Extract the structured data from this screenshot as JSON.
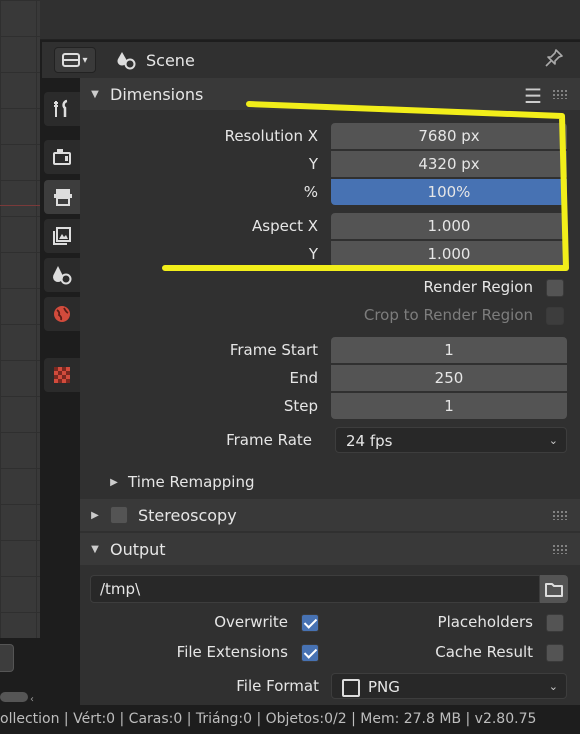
{
  "header": {
    "scene_label": "Scene"
  },
  "tabs": [
    "tool-icon",
    "render-icon",
    "output-icon",
    "view-layer-icon",
    "scene-icon",
    "world-icon",
    "texture-icon"
  ],
  "dimensions": {
    "title": "Dimensions",
    "resolution_x_label": "Resolution X",
    "resolution_x": "7680 px",
    "resolution_y_label": "Y",
    "resolution_y": "4320 px",
    "percent_label": "%",
    "percent": "100%",
    "aspect_x_label": "Aspect X",
    "aspect_x": "1.000",
    "aspect_y_label": "Y",
    "aspect_y": "1.000",
    "render_region_label": "Render Region",
    "crop_label": "Crop to Render Region",
    "frame_start_label": "Frame Start",
    "frame_start": "1",
    "end_label": "End",
    "end": "250",
    "step_label": "Step",
    "step": "1",
    "frame_rate_label": "Frame Rate",
    "frame_rate": "24 fps",
    "time_remapping_label": "Time Remapping"
  },
  "stereoscopy": {
    "title": "Stereoscopy"
  },
  "output": {
    "title": "Output",
    "path": "/tmp\\",
    "overwrite_label": "Overwrite",
    "placeholders_label": "Placeholders",
    "file_extensions_label": "File Extensions",
    "cache_result_label": "Cache Result",
    "file_format_label": "File Format",
    "file_format": "PNG"
  },
  "status_bar": {
    "text": "ollection | Vért:0 | Caras:0 | Triáng:0 | Objetos:0/2 | Mem: 27.8 MB | v2.80.75"
  },
  "colors": {
    "accent": "#4772b3",
    "highlight_annotation": "#f2ee1a"
  }
}
